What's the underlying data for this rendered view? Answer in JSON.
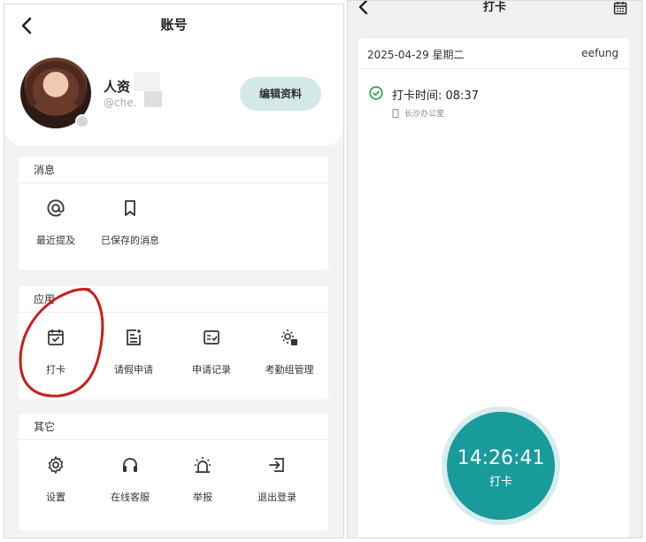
{
  "left": {
    "header": {
      "title": "账号",
      "back_icon": "chevron-left-icon"
    },
    "profile": {
      "name": "人资",
      "handle": "@che.",
      "edit_label": "编辑资料",
      "accent": "#d3e9e8"
    },
    "sections": [
      {
        "title": "消息",
        "items": [
          {
            "label": "最近提及",
            "icon": "at-icon"
          },
          {
            "label": "已保存的消息",
            "icon": "bookmark-icon"
          }
        ]
      },
      {
        "title": "应用",
        "items": [
          {
            "label": "打卡",
            "icon": "calendar-check-icon"
          },
          {
            "label": "请假申请",
            "icon": "leave-request-icon"
          },
          {
            "label": "申请记录",
            "icon": "application-record-icon"
          },
          {
            "label": "考勤组管理",
            "icon": "attendance-group-icon"
          }
        ]
      },
      {
        "title": "其它",
        "items": [
          {
            "label": "设置",
            "icon": "gear-icon"
          },
          {
            "label": "在线客服",
            "icon": "headset-icon"
          },
          {
            "label": "举报",
            "icon": "alarm-icon"
          },
          {
            "label": "退出登录",
            "icon": "logout-icon"
          }
        ]
      }
    ],
    "annotation_color": "#c81e1e"
  },
  "right": {
    "header": {
      "title": "打卡",
      "back_icon": "chevron-left-icon",
      "calendar_icon": "calendar-icon"
    },
    "date_line": "2025-04-29 星期二",
    "user": "eefung",
    "punch": {
      "time_text": "打卡时间: 08:37",
      "location": "长沙办公室",
      "status_color": "#1e9e44"
    },
    "clock": {
      "time": "14:26:41",
      "label": "打卡",
      "color": "#199a9b"
    }
  }
}
